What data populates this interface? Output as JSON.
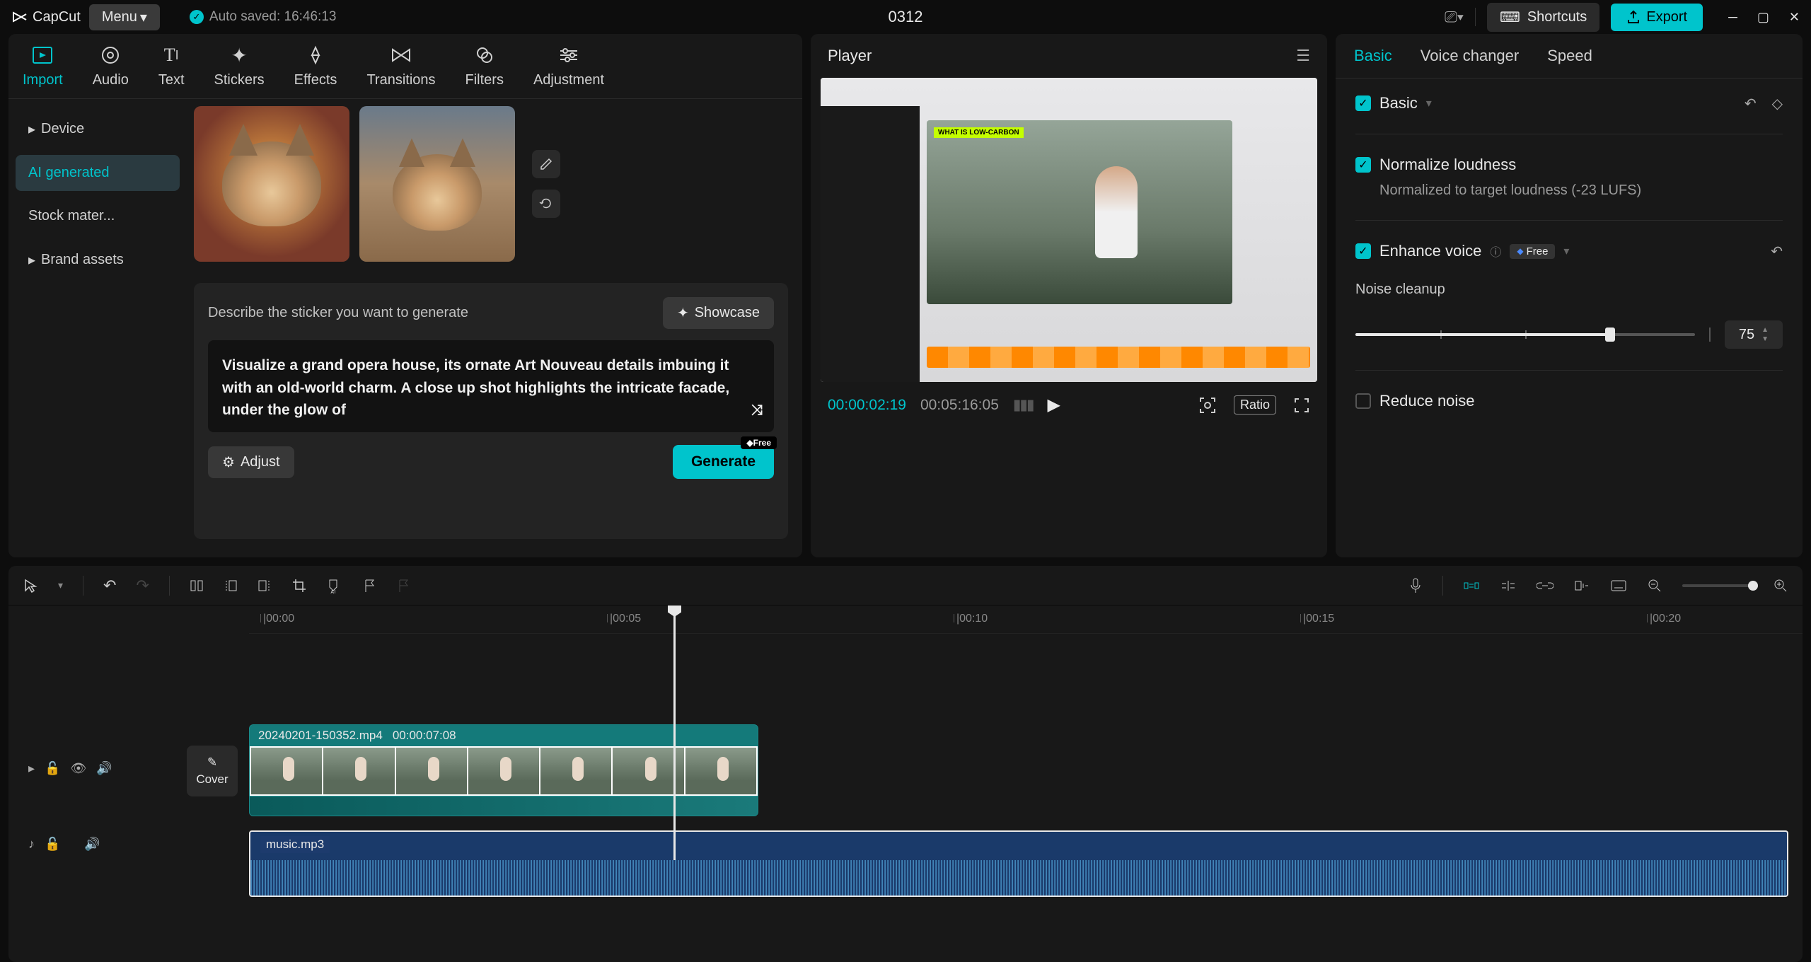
{
  "app": {
    "name": "CapCut",
    "menu": "Menu",
    "autosave": "Auto saved: 16:46:13",
    "project_title": "0312"
  },
  "titlebar": {
    "shortcuts": "Shortcuts",
    "export": "Export"
  },
  "left_tabs": [
    "Import",
    "Audio",
    "Text",
    "Stickers",
    "Effects",
    "Transitions",
    "Filters",
    "Adjustment"
  ],
  "left_side": [
    {
      "label": "Device",
      "expand": true
    },
    {
      "label": "AI generated",
      "expand": false
    },
    {
      "label": "Stock mater...",
      "expand": false
    },
    {
      "label": "Brand assets",
      "expand": true
    }
  ],
  "gen": {
    "describe": "Describe the sticker you want to generate",
    "showcase": "Showcase",
    "prompt": "Visualize a grand opera house, its ornate Art Nouveau details imbuing it with an old-world charm. A close up shot highlights the intricate facade, under the glow of",
    "adjust": "Adjust",
    "generate": "Generate",
    "free": "◆Free"
  },
  "player": {
    "title": "Player",
    "caption": "WHAT IS LOW-CARBON",
    "tc_current": "00:00:02:19",
    "tc_total": "00:05:16:05",
    "ratio": "Ratio"
  },
  "right": {
    "tabs": [
      "Basic",
      "Voice changer",
      "Speed"
    ],
    "basic": "Basic",
    "normalize": "Normalize loudness",
    "normalize_sub": "Normalized to target loudness (-23 LUFS)",
    "enhance": "Enhance voice",
    "free": "Free",
    "noise_cleanup": "Noise cleanup",
    "noise_value": "75",
    "reduce": "Reduce noise"
  },
  "timeline": {
    "marks": [
      "00:00",
      "00:05",
      "00:10",
      "00:15",
      "00:20"
    ],
    "video_clip": {
      "name": "20240201-150352.mp4",
      "dur": "00:00:07:08"
    },
    "audio_clip": {
      "name": "music.mp3"
    },
    "cover": "Cover"
  }
}
